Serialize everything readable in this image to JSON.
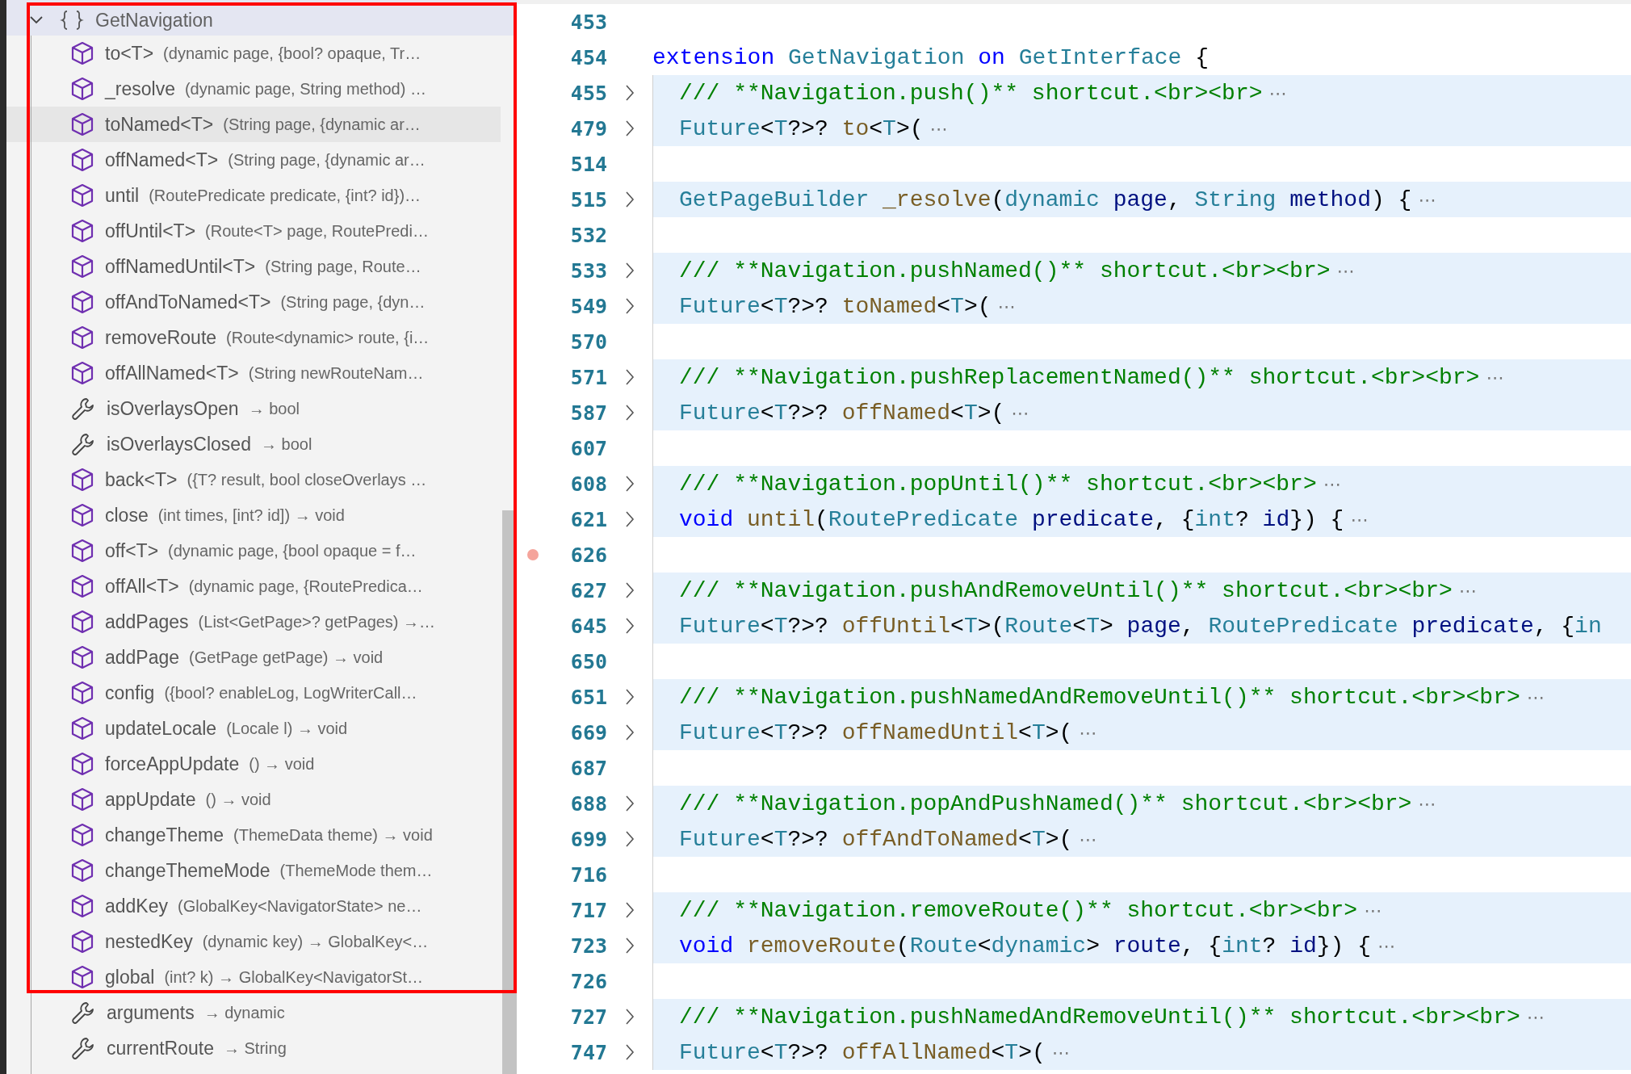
{
  "outline": {
    "header": {
      "label": "GetNavigation",
      "expanded": true,
      "selected": true
    },
    "items": [
      {
        "kind": "method",
        "name": "to<T>",
        "signature": "(dynamic page, {bool? opaque, Tr…",
        "hovered": false
      },
      {
        "kind": "method",
        "name": "_resolve",
        "signature": "(dynamic page, String method) …",
        "hovered": false
      },
      {
        "kind": "method",
        "name": "toNamed<T>",
        "signature": "(String page, {dynamic ar…",
        "hovered": true
      },
      {
        "kind": "method",
        "name": "offNamed<T>",
        "signature": "(String page, {dynamic ar…",
        "hovered": false
      },
      {
        "kind": "method",
        "name": "until",
        "signature": "(RoutePredicate predicate, {int? id})…",
        "hovered": false
      },
      {
        "kind": "method",
        "name": "offUntil<T>",
        "signature": "(Route<T> page, RoutePredi…",
        "hovered": false
      },
      {
        "kind": "method",
        "name": "offNamedUntil<T>",
        "signature": "(String page, Route…",
        "hovered": false
      },
      {
        "kind": "method",
        "name": "offAndToNamed<T>",
        "signature": "(String page, {dyn…",
        "hovered": false
      },
      {
        "kind": "method",
        "name": "removeRoute",
        "signature": "(Route<dynamic> route, {i…",
        "hovered": false
      },
      {
        "kind": "method",
        "name": "offAllNamed<T>",
        "signature": "(String newRouteNam…",
        "hovered": false
      },
      {
        "kind": "getter",
        "name": "isOverlaysOpen",
        "signature": "→ bool",
        "hovered": false
      },
      {
        "kind": "getter",
        "name": "isOverlaysClosed",
        "signature": "→ bool",
        "hovered": false
      },
      {
        "kind": "method",
        "name": "back<T>",
        "signature": "({T? result, bool closeOverlays …",
        "hovered": false
      },
      {
        "kind": "method",
        "name": "close",
        "signature": "(int times, [int? id]) → void",
        "hovered": false
      },
      {
        "kind": "method",
        "name": "off<T>",
        "signature": "(dynamic page, {bool opaque = f…",
        "hovered": false
      },
      {
        "kind": "method",
        "name": "offAll<T>",
        "signature": "(dynamic page, {RoutePredica…",
        "hovered": false
      },
      {
        "kind": "method",
        "name": "addPages",
        "signature": "(List<GetPage>? getPages) →…",
        "hovered": false
      },
      {
        "kind": "method",
        "name": "addPage",
        "signature": "(GetPage getPage) → void",
        "hovered": false
      },
      {
        "kind": "method",
        "name": "config",
        "signature": "({bool? enableLog, LogWriterCall…",
        "hovered": false
      },
      {
        "kind": "method",
        "name": "updateLocale",
        "signature": "(Locale l) → void",
        "hovered": false
      },
      {
        "kind": "method",
        "name": "forceAppUpdate",
        "signature": "() → void",
        "hovered": false
      },
      {
        "kind": "method",
        "name": "appUpdate",
        "signature": "() → void",
        "hovered": false
      },
      {
        "kind": "method",
        "name": "changeTheme",
        "signature": "(ThemeData theme) → void",
        "hovered": false
      },
      {
        "kind": "method",
        "name": "changeThemeMode",
        "signature": "(ThemeMode them…",
        "hovered": false
      },
      {
        "kind": "method",
        "name": "addKey",
        "signature": "(GlobalKey<NavigatorState> ne…",
        "hovered": false
      },
      {
        "kind": "method",
        "name": "nestedKey",
        "signature": "(dynamic key) → GlobalKey<…",
        "hovered": false
      },
      {
        "kind": "method",
        "name": "global",
        "signature": "(int? k) → GlobalKey<NavigatorSt…",
        "hovered": false
      },
      {
        "kind": "getter",
        "name": "arguments",
        "signature": "→ dynamic",
        "hovered": false
      },
      {
        "kind": "getter",
        "name": "currentRoute",
        "signature": "→ String",
        "hovered": false
      }
    ],
    "highlight_box": true
  },
  "editor": {
    "lines": [
      {
        "number": "453",
        "folded": false,
        "breakpoint": false
      },
      {
        "number": "454",
        "folded": false,
        "breakpoint": false,
        "tokens": [
          {
            "kind": "kw",
            "text": "extension "
          },
          {
            "kind": "type",
            "text": "GetNavigation "
          },
          {
            "kind": "kw",
            "text": "on "
          },
          {
            "kind": "type",
            "text": "GetInterface "
          },
          {
            "kind": "p",
            "text": "{"
          }
        ],
        "children": [
          {
            "number": "455",
            "folded": true,
            "breakpoint": false,
            "fold_marker": "⋯",
            "tokens": [
              {
                "kind": "cm",
                "text": "/// **Navigation.push()** shortcut.<br><br>"
              }
            ]
          },
          {
            "number": "479",
            "folded": true,
            "breakpoint": false,
            "fold_marker": "⋯",
            "tokens": [
              {
                "kind": "type",
                "text": "Future"
              },
              {
                "kind": "p",
                "text": "<"
              },
              {
                "kind": "type",
                "text": "T"
              },
              {
                "kind": "p",
                "text": "?>? "
              },
              {
                "kind": "fn",
                "text": "to"
              },
              {
                "kind": "p",
                "text": "<"
              },
              {
                "kind": "type",
                "text": "T"
              },
              {
                "kind": "p",
                "text": ">("
              }
            ]
          },
          {
            "number": "514",
            "folded": false,
            "breakpoint": false
          },
          {
            "number": "515",
            "folded": true,
            "breakpoint": false,
            "fold_marker": "⋯",
            "tokens": [
              {
                "kind": "type",
                "text": "GetPageBuilder "
              },
              {
                "kind": "fn",
                "text": "_resolve"
              },
              {
                "kind": "p",
                "text": "("
              },
              {
                "kind": "type",
                "text": "dynamic "
              },
              {
                "kind": "var",
                "text": "page"
              },
              {
                "kind": "p",
                "text": ", "
              },
              {
                "kind": "type",
                "text": "String "
              },
              {
                "kind": "var",
                "text": "method"
              },
              {
                "kind": "p",
                "text": ") {"
              }
            ]
          },
          {
            "number": "532",
            "folded": false,
            "breakpoint": false
          },
          {
            "number": "533",
            "folded": true,
            "breakpoint": false,
            "fold_marker": "⋯",
            "tokens": [
              {
                "kind": "cm",
                "text": "/// **Navigation.pushNamed()** shortcut.<br><br>"
              }
            ]
          },
          {
            "number": "549",
            "folded": true,
            "breakpoint": false,
            "fold_marker": "⋯",
            "tokens": [
              {
                "kind": "type",
                "text": "Future"
              },
              {
                "kind": "p",
                "text": "<"
              },
              {
                "kind": "type",
                "text": "T"
              },
              {
                "kind": "p",
                "text": "?>? "
              },
              {
                "kind": "fn",
                "text": "toNamed"
              },
              {
                "kind": "p",
                "text": "<"
              },
              {
                "kind": "type",
                "text": "T"
              },
              {
                "kind": "p",
                "text": ">("
              }
            ]
          },
          {
            "number": "570",
            "folded": false,
            "breakpoint": false
          },
          {
            "number": "571",
            "folded": true,
            "breakpoint": false,
            "fold_marker": "⋯",
            "tokens": [
              {
                "kind": "cm",
                "text": "/// **Navigation.pushReplacementNamed()** shortcut.<br><br>"
              }
            ]
          },
          {
            "number": "587",
            "folded": true,
            "breakpoint": false,
            "fold_marker": "⋯",
            "tokens": [
              {
                "kind": "type",
                "text": "Future"
              },
              {
                "kind": "p",
                "text": "<"
              },
              {
                "kind": "type",
                "text": "T"
              },
              {
                "kind": "p",
                "text": "?>? "
              },
              {
                "kind": "fn",
                "text": "offNamed"
              },
              {
                "kind": "p",
                "text": "<"
              },
              {
                "kind": "type",
                "text": "T"
              },
              {
                "kind": "p",
                "text": ">("
              }
            ]
          },
          {
            "number": "607",
            "folded": false,
            "breakpoint": false
          },
          {
            "number": "608",
            "folded": true,
            "breakpoint": false,
            "fold_marker": "⋯",
            "tokens": [
              {
                "kind": "cm",
                "text": "/// **Navigation.popUntil()** shortcut.<br><br>"
              }
            ]
          },
          {
            "number": "621",
            "folded": true,
            "breakpoint": false,
            "fold_marker": "⋯",
            "tokens": [
              {
                "kind": "kw",
                "text": "void "
              },
              {
                "kind": "fn",
                "text": "until"
              },
              {
                "kind": "p",
                "text": "("
              },
              {
                "kind": "type",
                "text": "RoutePredicate "
              },
              {
                "kind": "var",
                "text": "predicate"
              },
              {
                "kind": "p",
                "text": ", {"
              },
              {
                "kind": "type",
                "text": "int"
              },
              {
                "kind": "p",
                "text": "? "
              },
              {
                "kind": "var",
                "text": "id"
              },
              {
                "kind": "p",
                "text": "}) {"
              }
            ]
          },
          {
            "number": "626",
            "folded": false,
            "breakpoint": true
          },
          {
            "number": "627",
            "folded": true,
            "breakpoint": false,
            "fold_marker": "⋯",
            "tokens": [
              {
                "kind": "cm",
                "text": "/// **Navigation.pushAndRemoveUntil()** shortcut.<br><br>"
              }
            ]
          },
          {
            "number": "645",
            "folded": true,
            "breakpoint": false,
            "tokens": [
              {
                "kind": "type",
                "text": "Future"
              },
              {
                "kind": "p",
                "text": "<"
              },
              {
                "kind": "type",
                "text": "T"
              },
              {
                "kind": "p",
                "text": "?>? "
              },
              {
                "kind": "fn",
                "text": "offUntil"
              },
              {
                "kind": "p",
                "text": "<"
              },
              {
                "kind": "type",
                "text": "T"
              },
              {
                "kind": "p",
                "text": ">("
              },
              {
                "kind": "type",
                "text": "Route"
              },
              {
                "kind": "p",
                "text": "<"
              },
              {
                "kind": "type",
                "text": "T"
              },
              {
                "kind": "p",
                "text": "> "
              },
              {
                "kind": "var",
                "text": "page"
              },
              {
                "kind": "p",
                "text": ", "
              },
              {
                "kind": "type",
                "text": "RoutePredicate "
              },
              {
                "kind": "var",
                "text": "predicate"
              },
              {
                "kind": "p",
                "text": ", {"
              },
              {
                "kind": "type",
                "text": "in"
              }
            ]
          },
          {
            "number": "650",
            "folded": false,
            "breakpoint": false
          },
          {
            "number": "651",
            "folded": true,
            "breakpoint": false,
            "fold_marker": "⋯",
            "tokens": [
              {
                "kind": "cm",
                "text": "/// **Navigation.pushNamedAndRemoveUntil()** shortcut.<br><br>"
              }
            ]
          },
          {
            "number": "669",
            "folded": true,
            "breakpoint": false,
            "fold_marker": "⋯",
            "tokens": [
              {
                "kind": "type",
                "text": "Future"
              },
              {
                "kind": "p",
                "text": "<"
              },
              {
                "kind": "type",
                "text": "T"
              },
              {
                "kind": "p",
                "text": "?>? "
              },
              {
                "kind": "fn",
                "text": "offNamedUntil"
              },
              {
                "kind": "p",
                "text": "<"
              },
              {
                "kind": "type",
                "text": "T"
              },
              {
                "kind": "p",
                "text": ">("
              }
            ]
          },
          {
            "number": "687",
            "folded": false,
            "breakpoint": false
          },
          {
            "number": "688",
            "folded": true,
            "breakpoint": false,
            "fold_marker": "⋯",
            "tokens": [
              {
                "kind": "cm",
                "text": "/// **Navigation.popAndPushNamed()** shortcut.<br><br>"
              }
            ]
          },
          {
            "number": "699",
            "folded": true,
            "breakpoint": false,
            "fold_marker": "⋯",
            "tokens": [
              {
                "kind": "type",
                "text": "Future"
              },
              {
                "kind": "p",
                "text": "<"
              },
              {
                "kind": "type",
                "text": "T"
              },
              {
                "kind": "p",
                "text": "?>? "
              },
              {
                "kind": "fn",
                "text": "offAndToNamed"
              },
              {
                "kind": "p",
                "text": "<"
              },
              {
                "kind": "type",
                "text": "T"
              },
              {
                "kind": "p",
                "text": ">("
              }
            ]
          },
          {
            "number": "716",
            "folded": false,
            "breakpoint": false
          },
          {
            "number": "717",
            "folded": true,
            "breakpoint": false,
            "fold_marker": "⋯",
            "tokens": [
              {
                "kind": "cm",
                "text": "/// **Navigation.removeRoute()** shortcut.<br><br>"
              }
            ]
          },
          {
            "number": "723",
            "folded": true,
            "breakpoint": false,
            "fold_marker": "⋯",
            "tokens": [
              {
                "kind": "kw",
                "text": "void "
              },
              {
                "kind": "fn",
                "text": "removeRoute"
              },
              {
                "kind": "p",
                "text": "("
              },
              {
                "kind": "type",
                "text": "Route"
              },
              {
                "kind": "p",
                "text": "<"
              },
              {
                "kind": "type",
                "text": "dynamic"
              },
              {
                "kind": "p",
                "text": "> "
              },
              {
                "kind": "var",
                "text": "route"
              },
              {
                "kind": "p",
                "text": ", {"
              },
              {
                "kind": "type",
                "text": "int"
              },
              {
                "kind": "p",
                "text": "? "
              },
              {
                "kind": "var",
                "text": "id"
              },
              {
                "kind": "p",
                "text": "}) {"
              }
            ]
          },
          {
            "number": "726",
            "folded": false,
            "breakpoint": false
          },
          {
            "number": "727",
            "folded": true,
            "breakpoint": false,
            "fold_marker": "⋯",
            "tokens": [
              {
                "kind": "cm",
                "text": "/// **Navigation.pushNamedAndRemoveUntil()** shortcut.<br><br>"
              }
            ]
          },
          {
            "number": "747",
            "folded": true,
            "breakpoint": false,
            "fold_marker": "⋯",
            "tokens": [
              {
                "kind": "type",
                "text": "Future"
              },
              {
                "kind": "p",
                "text": "<"
              },
              {
                "kind": "type",
                "text": "T"
              },
              {
                "kind": "p",
                "text": "?>? "
              },
              {
                "kind": "fn",
                "text": "offAllNamed"
              },
              {
                "kind": "p",
                "text": "<"
              },
              {
                "kind": "type",
                "text": "T"
              },
              {
                "kind": "p",
                "text": ">("
              }
            ]
          }
        ]
      }
    ]
  }
}
